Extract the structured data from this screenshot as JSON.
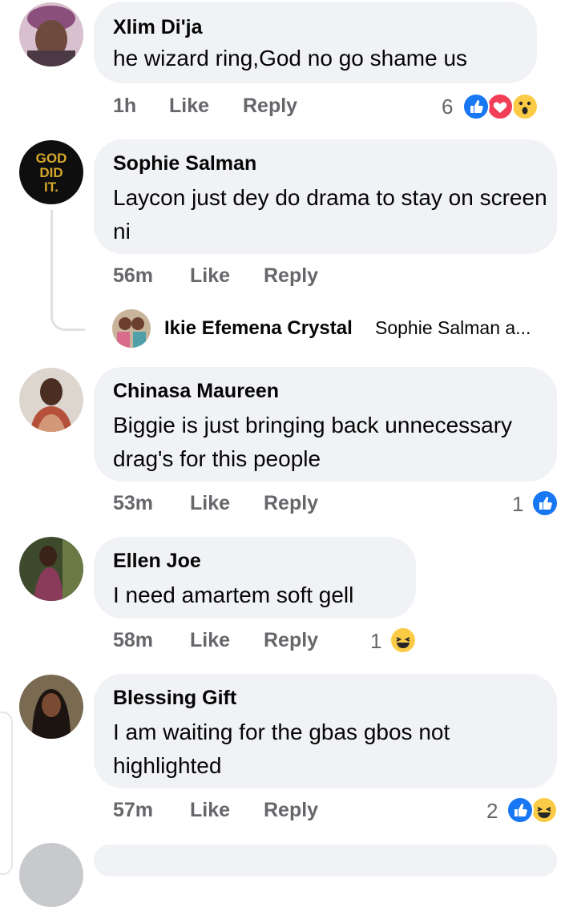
{
  "comments": [
    {
      "author": "Xlim Di'ja",
      "text": "he wizard ring,God no go shame us",
      "time": "1h",
      "like": "Like",
      "reply": "Reply",
      "reaction_count": "6",
      "reactions": [
        "like-icon",
        "love-icon",
        "wow-icon"
      ]
    },
    {
      "author": "Sophie Salman",
      "text": "Laycon just dey do drama to stay on screen ni",
      "time": "56m",
      "like": "Like",
      "reply": "Reply",
      "avatar_text": [
        "GOD",
        "DID",
        "IT."
      ]
    },
    {
      "author": "Chinasa Maureen",
      "text": "Biggie is just bringing back unnecessary drag's for this people",
      "time": "53m",
      "like": "Like",
      "reply": "Reply",
      "reaction_count": "1",
      "reactions": [
        "like-icon"
      ]
    },
    {
      "author": "Ellen Joe",
      "text": "I need amartem soft gell",
      "time": "58m",
      "like": "Like",
      "reply": "Reply",
      "reaction_count": "1",
      "reactions": [
        "haha-icon"
      ]
    },
    {
      "author": "Blessing Gift",
      "text": "I am waiting for the gbas gbos not highlighted",
      "time": "57m",
      "like": "Like",
      "reply": "Reply",
      "reaction_count": "2",
      "reactions": [
        "like-icon",
        "haha-icon"
      ]
    }
  ],
  "reply_preview": {
    "author": "Ikie Efemena Crystal",
    "snippet": "Sophie Salman  a..."
  }
}
